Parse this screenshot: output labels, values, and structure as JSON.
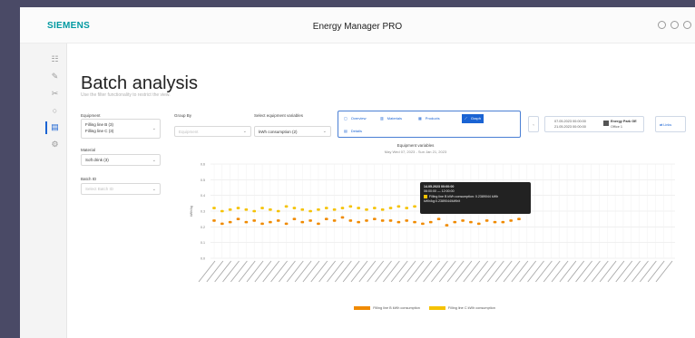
{
  "header": {
    "brand": "SIEMENS",
    "app_title": "Energy Manager PRO",
    "icons": [
      "user-icon",
      "help-icon",
      "menu-icon"
    ]
  },
  "nav": {
    "items": [
      {
        "name": "hierarchy-icon",
        "glyph": "☷"
      },
      {
        "name": "edit-icon",
        "glyph": "✎"
      },
      {
        "name": "tools-icon",
        "glyph": "✂"
      },
      {
        "name": "bulb-icon",
        "glyph": "○"
      },
      {
        "name": "analysis-icon",
        "glyph": "▤"
      },
      {
        "name": "settings-icon",
        "glyph": "⚙"
      }
    ],
    "active_index": 4
  },
  "page": {
    "title": "Batch analysis",
    "subtitle": "Use the filter functionality to restrict the view."
  },
  "filters": {
    "equipment_label": "Equipment",
    "equipment_values": [
      "Filling line B (3)",
      "Filling line C (3)"
    ],
    "material_label": "Material",
    "material_value": "Soft drink (3)",
    "batch_label": "Batch ID",
    "batch_placeholder": "Select Batch ID",
    "group_by_label": "Group By",
    "group_by_placeholder": "Equipment",
    "variables_label": "Select equipment variables",
    "variables_value": "kWh consumption (2)"
  },
  "views": {
    "row1": [
      "Overview",
      "Materials",
      "Products",
      "Graph"
    ],
    "row2": [
      "Details"
    ],
    "active": "Graph"
  },
  "range": {
    "start": "07.05.2023 00:00:00",
    "end": "21.05.2023 00:00:00",
    "site": "Energy Park GE",
    "office": "Office 1",
    "reset_label": "Links"
  },
  "chart_data": {
    "type": "scatter",
    "title": "Equipment variables",
    "subtitle": "May Wed 07, 2023 - Sun Jan 21, 2023",
    "ylabel": "kWh/kg",
    "yticks": [
      0.0,
      0.1,
      0.2,
      0.3,
      0.4,
      0.5,
      0.6
    ],
    "ylim": [
      0,
      0.6
    ],
    "grid": true,
    "legend_position": "bottom",
    "x_count": 58,
    "series": [
      {
        "name": "Filling line B kWh consumption",
        "color": "#f08a00",
        "values": [
          0.24,
          0.22,
          0.23,
          0.25,
          0.23,
          0.24,
          0.22,
          0.23,
          0.24,
          0.22,
          0.25,
          0.23,
          0.24,
          0.22,
          0.25,
          0.24,
          0.26,
          0.24,
          0.23,
          0.24,
          0.25,
          0.24,
          0.24,
          0.23,
          0.24,
          0.23,
          0.22,
          0.23,
          0.25,
          0.21,
          0.23,
          0.24,
          0.23,
          0.22,
          0.24,
          0.23,
          0.23,
          0.24,
          0.25
        ]
      },
      {
        "name": "Filling line C kWh consumption",
        "color": "#f5c200",
        "values": [
          0.32,
          0.3,
          0.31,
          0.32,
          0.31,
          0.3,
          0.32,
          0.31,
          0.3,
          0.33,
          0.32,
          0.31,
          0.3,
          0.31,
          0.32,
          0.31,
          0.32,
          0.33,
          0.32,
          0.31,
          0.32,
          0.31,
          0.32,
          0.33,
          0.32,
          0.33,
          0.31,
          0.34,
          0.29,
          0.31,
          0.32,
          0.33,
          0.32,
          0.31,
          0.33,
          0.32,
          0.33
        ]
      }
    ]
  },
  "tooltip": {
    "lines": [
      "14.05.2023 00:00:00",
      "06:00:00 — 12:00:00",
      "Filling line B kWh consumption: 0.2389044 kWh",
      "kWh/kg:0.2389044/kWh/t"
    ]
  }
}
